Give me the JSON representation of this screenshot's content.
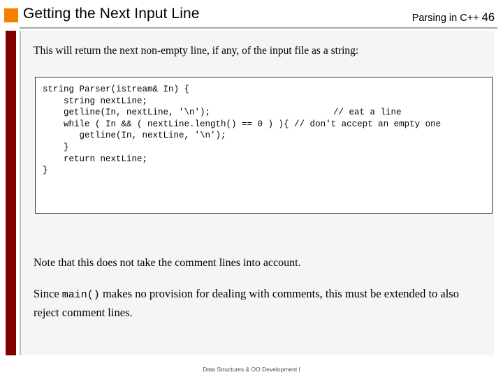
{
  "header": {
    "title": "Getting the Next Input Line",
    "course_label": "Parsing in C++",
    "page_number": "46",
    "accent_color": "#f77f00",
    "rule_color": "#a6a6a6"
  },
  "sidebar": {
    "bar_color": "#800000"
  },
  "main": {
    "intro": "This will return the next non-empty line, if any, of the input file as a string:",
    "code": {
      "lines": [
        "string Parser(istream& In) {",
        "",
        "    string nextLine;",
        "    getline(In, nextLine, '\\n');",
        "",
        "    while ( In && ( nextLine.length() == 0 ) ){ // don't accept an empty one",
        "       getline(In, nextLine, '\\n');",
        "    }",
        "",
        "    return nextLine;",
        "}"
      ],
      "inline_comment_getline": "// eat a line",
      "border_color": "#3a3a3a",
      "background": "#ffffff"
    },
    "note_paragraph": "Note that this does not take the comment lines into account.",
    "since_paragraph": {
      "before": "Since ",
      "mono": "main()",
      "after": " makes no provision for dealing with comments, this must be extended to also reject comment lines."
    },
    "panel_background": "#f5f5f5"
  },
  "footer": {
    "text": "Data Structures & OO Development I"
  }
}
